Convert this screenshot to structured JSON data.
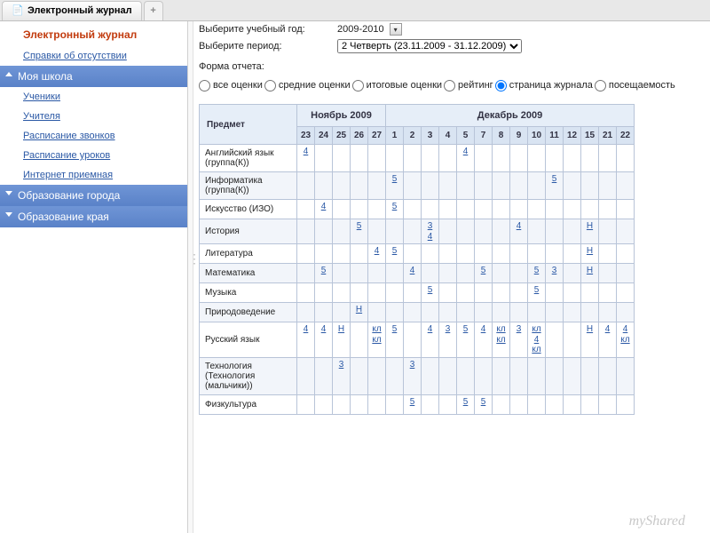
{
  "tab": {
    "title": "Электронный журнал",
    "add": "+"
  },
  "sidebar": {
    "title": "Электронный журнал",
    "link_absence": "Справки об отсутствии",
    "cat_school": "Моя школа",
    "items": [
      "Ученики",
      "Учителя",
      "Расписание звонков",
      "Расписание уроков",
      "Интернет приемная"
    ],
    "cat_city": "Образование города",
    "cat_region": "Образование края"
  },
  "controls": {
    "year_label": "Выберите учебный год:",
    "year_value": "2009-2010",
    "period_label": "Выберите период:",
    "period_value": "2 Четверть (23.11.2009 - 31.12.2009)",
    "form_label": "Форма отчета:",
    "radios": [
      {
        "label": "все оценки",
        "checked": false
      },
      {
        "label": "средние оценки",
        "checked": false
      },
      {
        "label": "итоговые оценки",
        "checked": false
      },
      {
        "label": "рейтинг",
        "checked": false
      },
      {
        "label": "страница журнала",
        "checked": true
      },
      {
        "label": "посещаемость",
        "checked": false
      }
    ]
  },
  "table": {
    "subject_header": "Предмет",
    "months": [
      {
        "name": "Ноябрь 2009",
        "days": [
          "23",
          "24",
          "25",
          "26",
          "27"
        ]
      },
      {
        "name": "Декабрь 2009",
        "days": [
          "1",
          "2",
          "3",
          "4",
          "5",
          "7",
          "8",
          "9",
          "10",
          "11",
          "12",
          "15",
          "21",
          "22"
        ]
      }
    ],
    "rows": [
      {
        "subject": "Английский язык (группа(К))",
        "cells": {
          "23": [
            "4"
          ],
          "5": [
            "4"
          ]
        }
      },
      {
        "subject": "Информатика (группа(К))",
        "cells": {
          "1": [
            "5"
          ],
          "11": [
            "5"
          ]
        }
      },
      {
        "subject": "Искусство (ИЗО)",
        "cells": {
          "24": [
            "4"
          ],
          "1": [
            "5"
          ]
        }
      },
      {
        "subject": "История",
        "cells": {
          "26": [
            "5"
          ],
          "3": [
            "3",
            "4"
          ],
          "9": [
            "4"
          ],
          "15": [
            "Н"
          ]
        }
      },
      {
        "subject": "Литература",
        "cells": {
          "27": [
            "4"
          ],
          "1": [
            "5"
          ],
          "15": [
            "Н"
          ]
        }
      },
      {
        "subject": "Математика",
        "cells": {
          "24": [
            "5"
          ],
          "2": [
            "4"
          ],
          "7": [
            "5"
          ],
          "10": [
            "5"
          ],
          "11": [
            "3"
          ],
          "15": [
            "Н"
          ]
        }
      },
      {
        "subject": "Музыка",
        "cells": {
          "3": [
            "5"
          ],
          "10": [
            "5"
          ]
        }
      },
      {
        "subject": "Природоведение",
        "cells": {
          "26": [
            "Н"
          ]
        }
      },
      {
        "subject": "Русский язык",
        "cells": {
          "23": [
            "4"
          ],
          "24": [
            "4"
          ],
          "25": [
            "Н"
          ],
          "27": [
            "кл",
            "кл"
          ],
          "1": [
            "5"
          ],
          "3": [
            "4"
          ],
          "4": [
            "3"
          ],
          "5": [
            "5"
          ],
          "7": [
            "4"
          ],
          "8": [
            "кл",
            "кл"
          ],
          "9": [
            "3"
          ],
          "10": [
            "кл",
            "4",
            "кл"
          ],
          "15": [
            "Н"
          ],
          "21": [
            "4"
          ],
          "22": [
            "4",
            "кл"
          ]
        }
      },
      {
        "subject": "Технология (Технология (мальчики))",
        "cells": {
          "25": [
            "3"
          ],
          "2": [
            "3"
          ]
        }
      },
      {
        "subject": "Физкультура",
        "cells": {
          "2": [
            "5"
          ],
          "5": [
            "5"
          ],
          "7": [
            "5"
          ]
        }
      }
    ]
  },
  "watermark": "myShared"
}
